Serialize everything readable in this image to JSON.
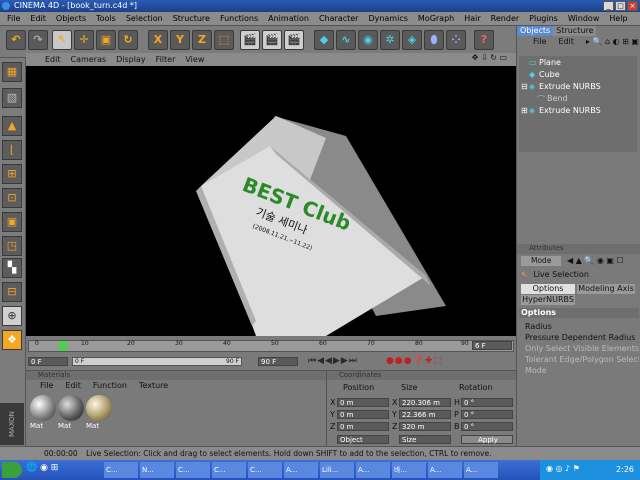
{
  "window": {
    "title": "CINEMA 4D - [book_turn.c4d *]"
  },
  "menu": [
    "File",
    "Edit",
    "Objects",
    "Tools",
    "Selection",
    "Structure",
    "Functions",
    "Animation",
    "Character",
    "Dynamics",
    "MoGraph",
    "Hair",
    "Render",
    "Plugins",
    "Window",
    "Help"
  ],
  "toolbar_icons": [
    "undo-icon",
    "redo-icon",
    "live-selection-icon",
    "move-icon",
    "scale-icon",
    "rotate-icon",
    "x-axis-icon",
    "y-axis-icon",
    "z-axis-icon",
    "coordinate-system-icon",
    "render-view-icon",
    "render-picture-viewer-icon",
    "render-settings-icon",
    "cube-primitive-icon",
    "spline-icon",
    "nurbs-icon",
    "array-icon",
    "deformer-icon",
    "scene-icon",
    "camera-icon",
    "light-icon"
  ],
  "axis_labels": [
    "X",
    "Y",
    "Z"
  ],
  "viewport": {
    "menu": [
      "Edit",
      "Cameras",
      "Display",
      "Filter",
      "View"
    ],
    "book_title": "BEST Club",
    "book_subtitle": "기술 세미나",
    "book_dates": "(2008.11.21.~11.22)"
  },
  "timeline": {
    "ticks": [
      "0",
      "10",
      "20",
      "30",
      "40",
      "50",
      "60",
      "70",
      "80",
      "90"
    ],
    "current_frame": "6 F",
    "start_field": "0 F",
    "range_start": "0 F",
    "range_end": "90 F",
    "end_field": "90 F"
  },
  "materials": {
    "header": "Materials",
    "menu": [
      "File",
      "Edit",
      "Function",
      "Texture"
    ],
    "items": [
      "Mat",
      "Mat",
      "Mat"
    ]
  },
  "coordinates": {
    "header": "Coordinates",
    "col_headers": [
      "Position",
      "Size",
      "Rotation"
    ],
    "rows": [
      {
        "axis": "X",
        "pos": "0 m",
        "size_axis": "X",
        "size": "220.306 m",
        "rot_axis": "H",
        "rot": "0 °"
      },
      {
        "axis": "Y",
        "pos": "0 m",
        "size_axis": "Y",
        "size": "22.366 m",
        "rot_axis": "P",
        "rot": "0 °"
      },
      {
        "axis": "Z",
        "pos": "0 m",
        "size_axis": "Z",
        "size": "320 m",
        "rot_axis": "B",
        "rot": "0 °"
      }
    ],
    "mode_select": "Object",
    "size_select": "Size",
    "apply": "Apply"
  },
  "objects": {
    "tabs": [
      "Objects",
      "Structure"
    ],
    "menu": [
      "File",
      "Edit"
    ],
    "items": [
      {
        "name": "Plane",
        "indent": 0
      },
      {
        "name": "Cube",
        "indent": 0
      },
      {
        "name": "Extrude NURBS",
        "indent": 0
      },
      {
        "name": "Bend",
        "indent": 1
      },
      {
        "name": "Extrude NURBS",
        "indent": 0
      }
    ]
  },
  "attributes": {
    "header": "Attributes",
    "mode": "Mode",
    "tool": "Live Selection",
    "tabs": [
      "Options",
      "Modeling Axis",
      "HyperNURBS"
    ],
    "section": "Options",
    "options": [
      "Radius",
      "Pressure Dependent Radius",
      "Only Select Visible Elements",
      "Tolerant Edge/Polygon Selection",
      "Mode"
    ]
  },
  "status": {
    "time": "00:00:00",
    "text": "Live Selection: Click and drag to select elements. Hold down SHIFT to add to the selection, CTRL to remove."
  },
  "taskbar": {
    "items": [
      "C...",
      "N...",
      "C...",
      "C...",
      "C...",
      "A...",
      "Lili...",
      "A...",
      "바...",
      "A...",
      "A..."
    ],
    "clock": "2:26"
  }
}
